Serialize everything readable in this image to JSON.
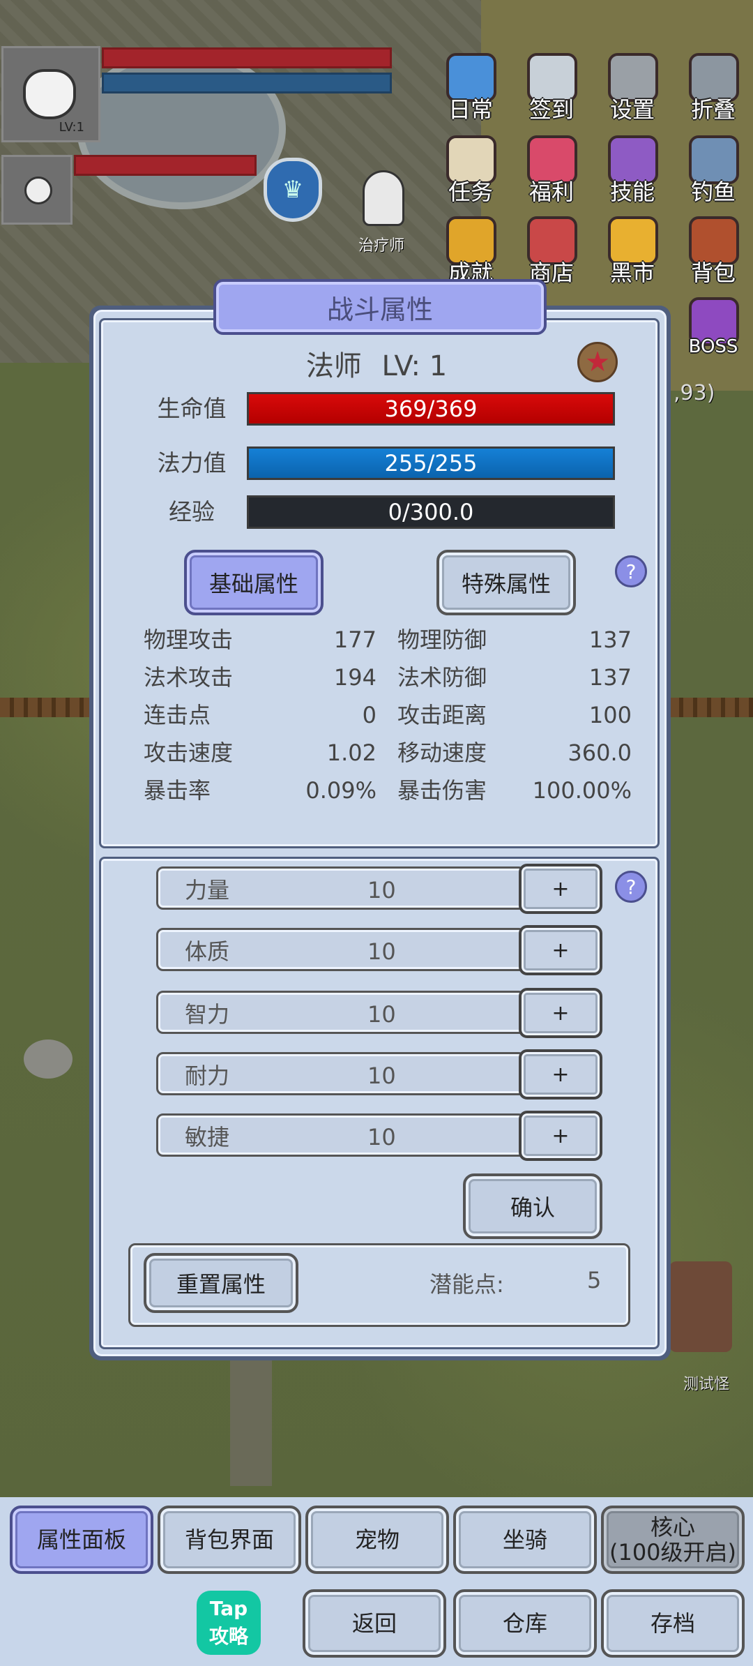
{
  "hud": {
    "level_badge": "LV:1",
    "npc_label": "治疗师",
    "far_label": "测试怪",
    "coord_fragment": ",93)"
  },
  "menu": [
    {
      "label": "日常",
      "icon": "clipboard-icon",
      "color": "#4a90d9"
    },
    {
      "label": "签到",
      "icon": "newspaper-icon",
      "color": "#c8d0d8"
    },
    {
      "label": "设置",
      "icon": "gear-icon",
      "color": "#9aa0a6"
    },
    {
      "label": "折叠",
      "icon": "collapse-icon",
      "color": "#8c96a0"
    },
    {
      "label": "任务",
      "icon": "scroll-icon",
      "color": "#e2d6b8"
    },
    {
      "label": "福利",
      "icon": "gift-icon",
      "color": "#d94a6a"
    },
    {
      "label": "技能",
      "icon": "spellbook-icon",
      "color": "#8e5bc4"
    },
    {
      "label": "钓鱼",
      "icon": "fish-icon",
      "color": "#6f8fb4"
    },
    {
      "label": "成就",
      "icon": "trophy-icon",
      "color": "#e0a52a"
    },
    {
      "label": "商店",
      "icon": "shop-icon",
      "color": "#c94848"
    },
    {
      "label": "黑市",
      "icon": "crown-icon",
      "color": "#e8b030"
    },
    {
      "label": "背包",
      "icon": "backpack-icon",
      "color": "#b0502e"
    },
    {
      "label": "BOSS",
      "icon": "boss-icon",
      "color": "#8e4ac0"
    }
  ],
  "panel": {
    "title": "战斗属性",
    "class_name": "法师",
    "level_text": "LV: 1",
    "hp": {
      "label": "生命值",
      "text": "369/369",
      "fraction": 1.0
    },
    "mp": {
      "label": "法力值",
      "text": "255/255",
      "fraction": 1.0
    },
    "exp": {
      "label": "经验",
      "text": "0/300.0",
      "fraction": 0.0
    },
    "tabs": {
      "basic": "基础属性",
      "special": "特殊属性"
    },
    "help_symbol": "?",
    "stats_left": [
      {
        "name": "物理攻击",
        "value": "177"
      },
      {
        "name": "法术攻击",
        "value": "194"
      },
      {
        "name": "连击点",
        "value": "0"
      },
      {
        "name": "攻击速度",
        "value": "1.02"
      },
      {
        "name": "暴击率",
        "value": "0.09%"
      }
    ],
    "stats_right": [
      {
        "name": "物理防御",
        "value": "137"
      },
      {
        "name": "法术防御",
        "value": "137"
      },
      {
        "name": "攻击距离",
        "value": "100"
      },
      {
        "name": "移动速度",
        "value": "360.0"
      },
      {
        "name": "暴击伤害",
        "value": "100.00%"
      }
    ],
    "attributes": [
      {
        "name": "力量",
        "value": "10",
        "plus": "+"
      },
      {
        "name": "体质",
        "value": "10",
        "plus": "+"
      },
      {
        "name": "智力",
        "value": "10",
        "plus": "+"
      },
      {
        "name": "耐力",
        "value": "10",
        "plus": "+"
      },
      {
        "name": "敏捷",
        "value": "10",
        "plus": "+"
      }
    ],
    "confirm": "确认",
    "reset": "重置属性",
    "potential_label": "潜能点:",
    "potential_value": "5"
  },
  "bottom": {
    "tabs": [
      "属性面板",
      "背包界面",
      "宠物",
      "坐骑",
      "核心\n(100级开启)"
    ],
    "actions": [
      "返回",
      "仓库",
      "存档"
    ],
    "tap_logo_top": "Tap",
    "tap_logo_bottom": "攻略"
  }
}
